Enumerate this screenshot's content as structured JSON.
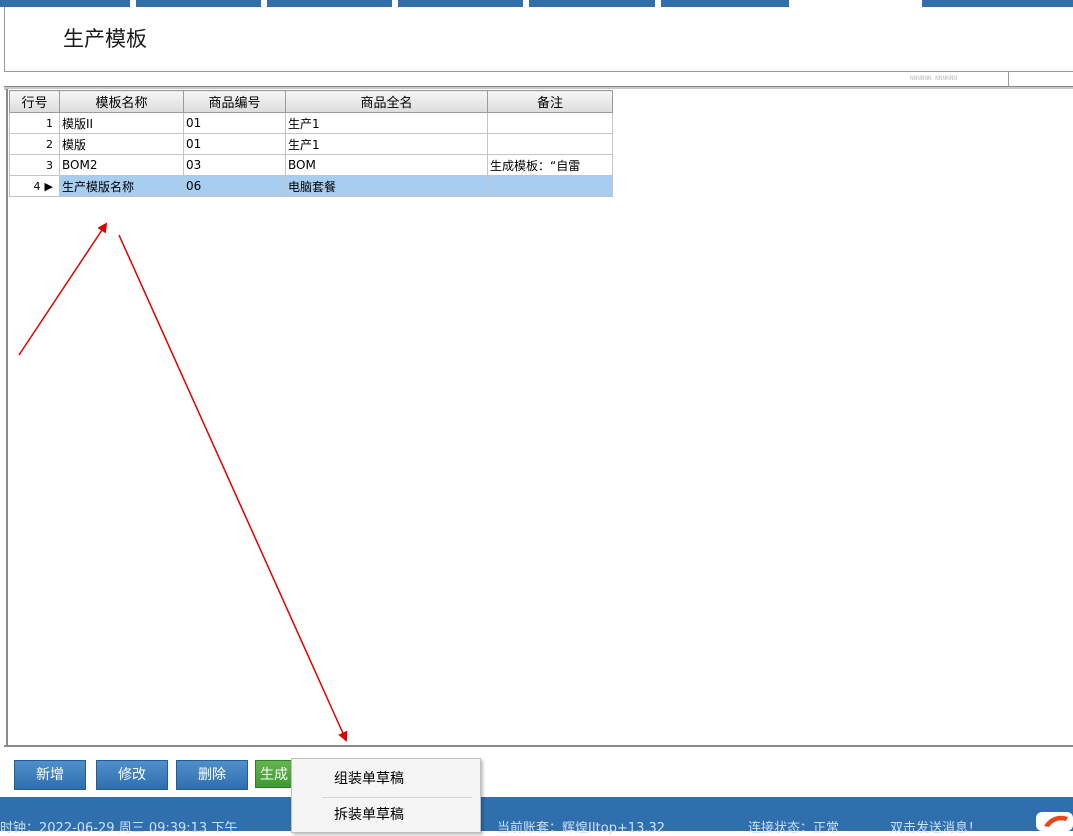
{
  "page": {
    "title": "生产模板"
  },
  "ruler_text": "NNNNNN NNNNNN",
  "table": {
    "columns": [
      "行号",
      "模板名称",
      "商品编号",
      "商品全名",
      "备注"
    ],
    "rows": [
      {
        "num": "1",
        "name": "模版II",
        "code": "01",
        "fullname": "生产1",
        "note": ""
      },
      {
        "num": "2",
        "name": "模版",
        "code": "01",
        "fullname": "生产1",
        "note": ""
      },
      {
        "num": "3",
        "name": "BOM2",
        "code": "03",
        "fullname": "BOM",
        "note": "生成模板：“自雷"
      },
      {
        "num": "4",
        "name": "生产模版名称",
        "code": "06",
        "fullname": "电脑套餐",
        "note": ""
      }
    ],
    "selected_row": 4
  },
  "toolbar": {
    "add": "新增",
    "edit": "修改",
    "delete": "删除",
    "generate": "生成"
  },
  "menu": {
    "items": [
      "组装单草稿",
      "拆装单草稿"
    ]
  },
  "status": {
    "clock": "时钟：2022-06-29 周三 09:39:13 下午",
    "account": "当前账套：辉煌IItop+13.32",
    "connection": "连接状态：正常",
    "message": "双击发送消息！"
  },
  "colors": {
    "accent": "#2f6fae",
    "selected_row": "#a7cdf0",
    "generate_button": "#3d9a2f",
    "annotation_arrow": "#e00000"
  }
}
